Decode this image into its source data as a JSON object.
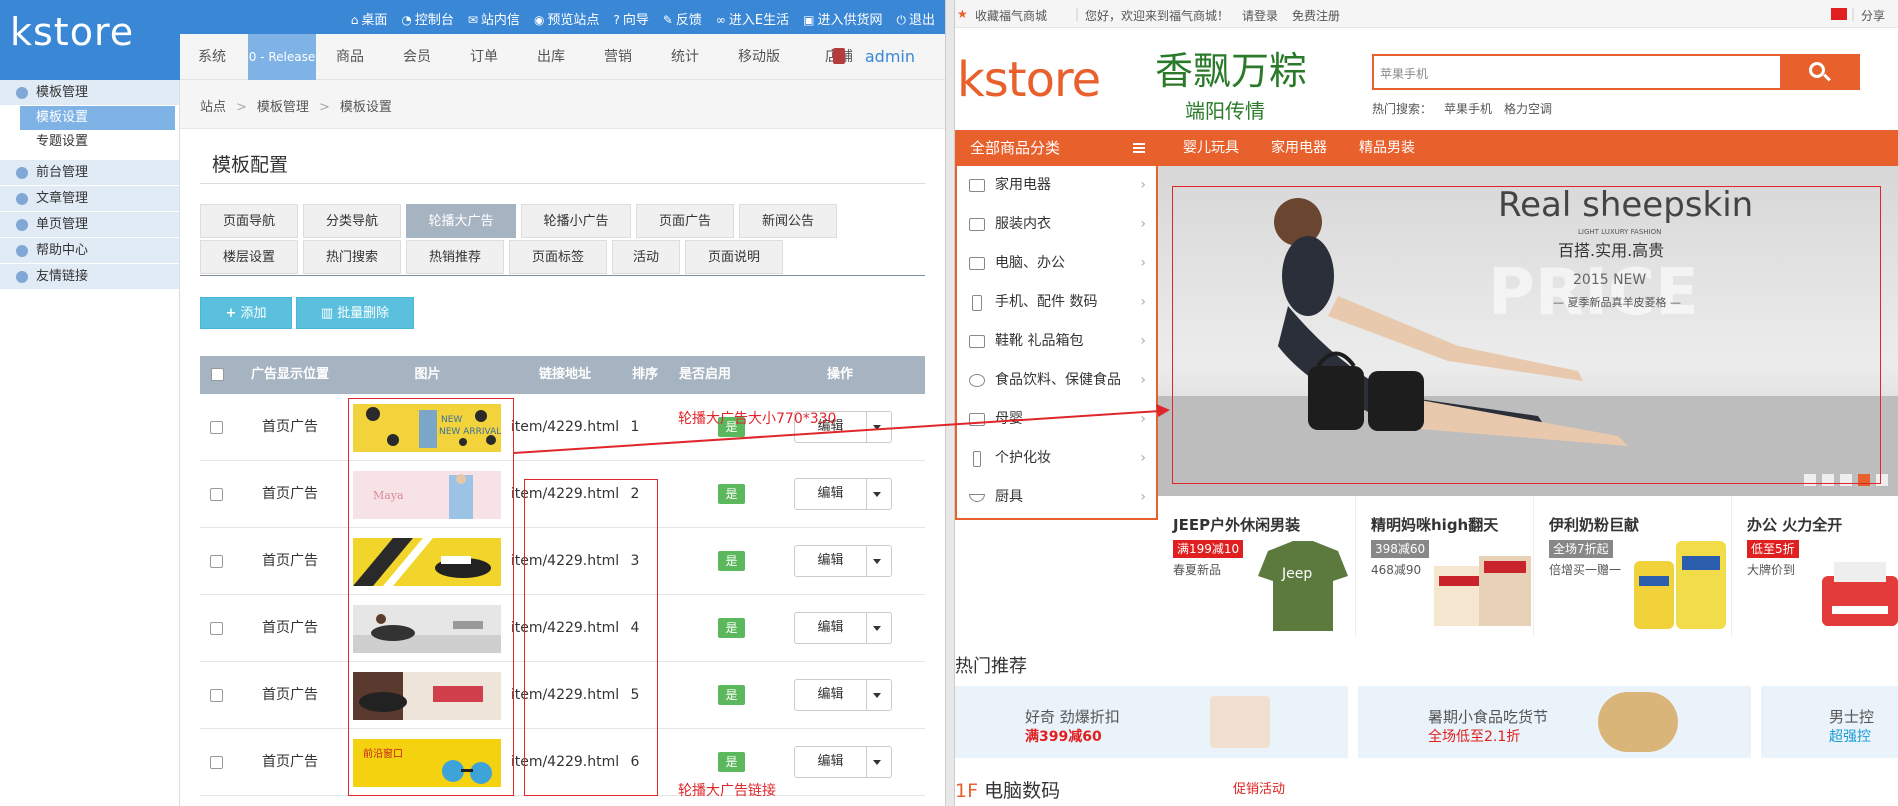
{
  "admin": {
    "logo": "kstore",
    "toplinks": [
      "桌面",
      "控制台",
      "站内信",
      "预览站点",
      "向导",
      "反馈",
      "进入E生活",
      "进入供货网",
      "退出"
    ],
    "nav": [
      "系统",
      "0 - Release",
      "商品",
      "会员",
      "订单",
      "出库",
      "营销",
      "统计",
      "移动版",
      "店铺"
    ],
    "user": "admin",
    "sidebar": {
      "groups": [
        "模板管理",
        "前台管理",
        "文章管理",
        "单页管理",
        "帮助中心",
        "友情链接"
      ],
      "subs": [
        "模板设置",
        "专题设置"
      ]
    },
    "breadcrumb": [
      "站点",
      "模板管理",
      "模板设置"
    ],
    "title": "模板配置",
    "tabs_row1": [
      "页面导航",
      "分类导航",
      "轮播大广告",
      "轮播小广告",
      "页面广告",
      "新闻公告"
    ],
    "tabs_row2": [
      "楼层设置",
      "热门搜索",
      "热销推荐",
      "页面标签",
      "活动",
      "页面说明"
    ],
    "add_label": "添加",
    "batch_delete_label": "批量删除",
    "table": {
      "headers": [
        "广告显示位置",
        "图片",
        "链接地址",
        "排序",
        "是否启用",
        "操作"
      ],
      "rows": [
        {
          "position": "首页广告",
          "link": "item/4229.html",
          "sort": "1",
          "enabled": "是",
          "action": "编辑",
          "thumb_text": "NEW ARRIVALS"
        },
        {
          "position": "首页广告",
          "link": "item/4229.html",
          "sort": "2",
          "enabled": "是",
          "action": "编辑",
          "thumb_text": "Maya"
        },
        {
          "position": "首页广告",
          "link": "item/4229.html",
          "sort": "3",
          "enabled": "是",
          "action": "编辑",
          "thumb_text": ""
        },
        {
          "position": "首页广告",
          "link": "item/4229.html",
          "sort": "4",
          "enabled": "是",
          "action": "编辑",
          "thumb_text": ""
        },
        {
          "position": "首页广告",
          "link": "item/4229.html",
          "sort": "5",
          "enabled": "是",
          "action": "编辑",
          "thumb_text": ""
        },
        {
          "position": "首页广告",
          "link": "item/4229.html",
          "sort": "6",
          "enabled": "是",
          "action": "编辑",
          "thumb_text": "前沿窗口"
        }
      ]
    },
    "annotation_size": "轮播大广告大小770*330",
    "annotation_link": "轮播大广告链接"
  },
  "store": {
    "topbar": {
      "fav": "收藏福气商城",
      "welcome": "您好，欢迎来到福气商城！",
      "login": "请登录",
      "register": "免费注册",
      "share": "分享"
    },
    "logo": "kstore",
    "brand": "香飘万粽",
    "brand_sub": "端阳传情",
    "search_placeholder": "苹果手机",
    "hot_search_label": "热门搜索：",
    "hot_search": [
      "苹果手机",
      "格力空调"
    ],
    "all_categories": "全部商品分类",
    "nav": [
      "婴儿玩具",
      "家用电器",
      "精品男装"
    ],
    "categories": [
      "家用电器",
      "服装内衣",
      "电脑、办公",
      "手机、配件  数码",
      "鞋靴  礼品箱包",
      "食品饮料、保健食品",
      "母婴",
      "个护化妆",
      "厨具"
    ],
    "banner": {
      "headline": "Real sheepskin",
      "tagline": "LIGHT LUXURY FASHION",
      "sub": "百搭.实用.高贵",
      "year": "2015 NEW",
      "caption": "— 夏季新品真羊皮菱格 —",
      "big": "PRICE"
    },
    "promos": [
      {
        "title": "JEEP户外休闲男装",
        "badge": "满199减10",
        "sub": "春夏新品",
        "badge_color": "#e02020"
      },
      {
        "title": "精明妈咪high翻天",
        "badge": "398减60",
        "sub": "468减90",
        "badge_color": "#888888"
      },
      {
        "title": "伊利奶粉巨献",
        "badge": "全场7折起",
        "sub": "倍增买一赠一",
        "badge_color": "#888888"
      },
      {
        "title": "办公 火力全开",
        "badge": "低至5折",
        "sub": "大牌价到",
        "badge_color": "#e02020"
      }
    ],
    "hot_rec_title": "热门推荐",
    "hot_rec": [
      {
        "t1": "好奇 劲爆折扣",
        "t2": "满399减60"
      },
      {
        "t1": "暑期小食品吃货节",
        "t2": "全场低至2.1折"
      },
      {
        "t1": "男士控",
        "t2": "超强控"
      }
    ],
    "floor_num": "1F",
    "floor_title": "电脑数码",
    "promo_label": "促销活动"
  }
}
